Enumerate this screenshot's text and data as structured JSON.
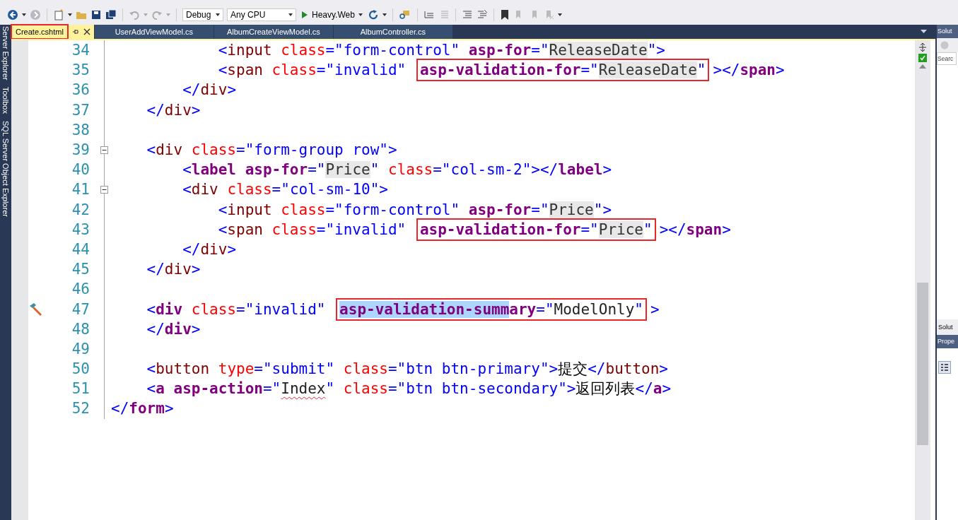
{
  "toolbar": {
    "configuration": "Debug",
    "platform": "Any CPU",
    "startup": "Heavy.Web"
  },
  "tabs": [
    {
      "label": "Create.cshtml",
      "selected": true,
      "boxed": true
    },
    {
      "label": "UserAddViewModel.cs",
      "selected": false,
      "boxed": false
    },
    {
      "label": "AlbumCreateViewModel.cs",
      "selected": false,
      "boxed": false
    },
    {
      "label": "AlbumController.cs",
      "selected": false,
      "boxed": false
    }
  ],
  "side_tabs": [
    "Server Explorer",
    "Toolbox",
    "SQL Server Object Explorer"
  ],
  "lines": [
    {
      "children": [
        {
          "children": [
            {
              "children": [
                {
                  "number": "34",
                  "segments": [
                    {
                      "boxed": false,
                      "tokens": [
                        {
                          "kind": "delim",
                          "text": "<"
                        },
                        {
                          "kind": "tag",
                          "text": "input "
                        },
                        {
                          "kind": "attr",
                          "text": "class"
                        },
                        {
                          "kind": "delim",
                          "text": "=\"form-control\" "
                        },
                        {
                          "kind": "helper",
                          "text": "asp-for"
                        },
                        {
                          "kind": "delim",
                          "text": "=\""
                        },
                        {
                          "kind": "model",
                          "text": "ReleaseDate"
                        },
                        {
                          "kind": "delim",
                          "text": "\">"
                        }
                      ]
                    }
                  ]
                },
                {
                  "number": "35",
                  "segments": [
                    {
                      "boxed": false,
                      "tokens": [
                        {
                          "kind": "delim",
                          "text": "<"
                        },
                        {
                          "kind": "tag",
                          "text": "span "
                        },
                        {
                          "kind": "attr",
                          "text": "class"
                        },
                        {
                          "kind": "delim",
                          "text": "=\"invalid\" "
                        }
                      ]
                    },
                    {
                      "boxed": true,
                      "tokens": [
                        {
                          "kind": "helper",
                          "text": "asp-validation-for"
                        },
                        {
                          "kind": "delim",
                          "text": "=\""
                        },
                        {
                          "kind": "model",
                          "text": "ReleaseDate"
                        },
                        {
                          "kind": "delim",
                          "text": "\""
                        }
                      ]
                    },
                    {
                      "boxed": false,
                      "tokens": [
                        {
                          "kind": "delim",
                          "text": "></"
                        },
                        {
                          "kind": "helper",
                          "text": "span"
                        },
                        {
                          "kind": "delim",
                          "text": ">"
                        }
                      ]
                    }
                  ]
                }
              ]
            },
            {
              "number": "36",
              "segments": [
                {
                  "boxed": false,
                  "tokens": [
                    {
                      "kind": "delim",
                      "text": "</"
                    },
                    {
                      "kind": "tag",
                      "text": "div"
                    },
                    {
                      "kind": "delim",
                      "text": ">"
                    }
                  ]
                }
              ]
            }
          ]
        },
        {
          "number": "37",
          "segments": [
            {
              "boxed": false,
              "tokens": [
                {
                  "kind": "delim",
                  "text": "</"
                },
                {
                  "kind": "tag",
                  "text": "div"
                },
                {
                  "kind": "delim",
                  "text": ">"
                }
              ]
            }
          ]
        },
        {
          "number": "38"
        },
        {
          "number": "39",
          "fold": true,
          "segments": [
            {
              "boxed": false,
              "tokens": [
                {
                  "kind": "delim",
                  "text": "<"
                },
                {
                  "kind": "tag",
                  "text": "div "
                },
                {
                  "kind": "attr",
                  "text": "class"
                },
                {
                  "kind": "delim",
                  "text": "=\"form-group row\">"
                }
              ]
            }
          ]
        },
        {
          "children": [
            {
              "number": "40",
              "segments": [
                {
                  "boxed": false,
                  "tokens": [
                    {
                      "kind": "delim",
                      "text": "<"
                    },
                    {
                      "kind": "helper",
                      "text": "label asp-for"
                    },
                    {
                      "kind": "delim",
                      "text": "=\""
                    },
                    {
                      "kind": "model",
                      "text": "Price"
                    },
                    {
                      "kind": "delim",
                      "text": "\" "
                    },
                    {
                      "kind": "attr",
                      "text": "class"
                    },
                    {
                      "kind": "delim",
                      "text": "=\"col-sm-2\"></"
                    },
                    {
                      "kind": "helper",
                      "text": "label"
                    },
                    {
                      "kind": "delim",
                      "text": ">"
                    }
                  ]
                }
              ]
            },
            {
              "number": "41",
              "fold": true,
              "segments": [
                {
                  "boxed": false,
                  "tokens": [
                    {
                      "kind": "delim",
                      "text": "<"
                    },
                    {
                      "kind": "tag",
                      "text": "div "
                    },
                    {
                      "kind": "attr",
                      "text": "class"
                    },
                    {
                      "kind": "delim",
                      "text": "=\"col-sm-10\">"
                    }
                  ]
                }
              ]
            },
            {
              "children": [
                {
                  "number": "42",
                  "segments": [
                    {
                      "boxed": false,
                      "tokens": [
                        {
                          "kind": "delim",
                          "text": "<"
                        },
                        {
                          "kind": "tag",
                          "text": "input "
                        },
                        {
                          "kind": "attr",
                          "text": "class"
                        },
                        {
                          "kind": "delim",
                          "text": "=\"form-control\" "
                        },
                        {
                          "kind": "helper",
                          "text": "asp-for"
                        },
                        {
                          "kind": "delim",
                          "text": "=\""
                        },
                        {
                          "kind": "model",
                          "text": "Price"
                        },
                        {
                          "kind": "delim",
                          "text": "\">"
                        }
                      ]
                    }
                  ]
                },
                {
                  "number": "43",
                  "segments": [
                    {
                      "boxed": false,
                      "tokens": [
                        {
                          "kind": "delim",
                          "text": "<"
                        },
                        {
                          "kind": "tag",
                          "text": "span "
                        },
                        {
                          "kind": "attr",
                          "text": "class"
                        },
                        {
                          "kind": "delim",
                          "text": "=\"invalid\" "
                        }
                      ]
                    },
                    {
                      "boxed": true,
                      "tokens": [
                        {
                          "kind": "helper",
                          "text": "asp-validation-for"
                        },
                        {
                          "kind": "delim",
                          "text": "=\""
                        },
                        {
                          "kind": "model",
                          "text": "Price"
                        },
                        {
                          "kind": "delim",
                          "text": "\""
                        }
                      ]
                    },
                    {
                      "boxed": false,
                      "tokens": [
                        {
                          "kind": "delim",
                          "text": "></"
                        },
                        {
                          "kind": "helper",
                          "text": "span"
                        },
                        {
                          "kind": "delim",
                          "text": ">"
                        }
                      ]
                    }
                  ]
                }
              ]
            },
            {
              "number": "44",
              "segments": [
                {
                  "boxed": false,
                  "tokens": [
                    {
                      "kind": "delim",
                      "text": "</"
                    },
                    {
                      "kind": "tag",
                      "text": "div"
                    },
                    {
                      "kind": "delim",
                      "text": ">"
                    }
                  ]
                }
              ]
            }
          ]
        },
        {
          "number": "45",
          "segments": [
            {
              "boxed": false,
              "tokens": [
                {
                  "kind": "delim",
                  "text": "</"
                },
                {
                  "kind": "tag",
                  "text": "div"
                },
                {
                  "kind": "delim",
                  "text": ">"
                }
              ]
            }
          ]
        },
        {
          "number": "46"
        },
        {
          "number": "47",
          "hammer": true,
          "segments": [
            {
              "boxed": false,
              "tokens": [
                {
                  "kind": "delim",
                  "text": "<"
                },
                {
                  "kind": "helper",
                  "text": "div "
                },
                {
                  "kind": "attr",
                  "text": "class"
                },
                {
                  "kind": "delim",
                  "text": "=\"invalid\" "
                }
              ]
            },
            {
              "boxed": true,
              "tokens": [
                {
                  "kind": "helper",
                  "text": "asp-validation-summ",
                  "selected": true
                },
                {
                  "kind": "helper",
                  "text": "ary",
                  "selected": false
                },
                {
                  "kind": "delim",
                  "text": "=\""
                },
                {
                  "kind": "value",
                  "text": "ModelOnly"
                },
                {
                  "kind": "delim",
                  "text": "\""
                }
              ]
            },
            {
              "boxed": false,
              "tokens": [
                {
                  "kind": "delim",
                  "text": ">"
                }
              ]
            }
          ]
        },
        {
          "number": "48",
          "segments": [
            {
              "boxed": false,
              "tokens": [
                {
                  "kind": "delim",
                  "text": "</"
                },
                {
                  "kind": "helper",
                  "text": "div"
                },
                {
                  "kind": "delim",
                  "text": ">"
                }
              ]
            }
          ]
        },
        {
          "number": "49"
        },
        {
          "number": "50",
          "segments": [
            {
              "boxed": false,
              "tokens": [
                {
                  "kind": "delim",
                  "text": "<"
                },
                {
                  "kind": "tag",
                  "text": "button "
                },
                {
                  "kind": "attr",
                  "text": "type"
                },
                {
                  "kind": "delim",
                  "text": "=\"submit\" "
                },
                {
                  "kind": "attr",
                  "text": "class"
                },
                {
                  "kind": "delim",
                  "text": "=\"btn btn-primary\">"
                },
                {
                  "kind": "text",
                  "text": "提交"
                },
                {
                  "kind": "delim",
                  "text": "</"
                },
                {
                  "kind": "tag",
                  "text": "button"
                },
                {
                  "kind": "delim",
                  "text": ">"
                }
              ]
            }
          ]
        },
        {
          "number": "51",
          "segments": [
            {
              "boxed": false,
              "tokens": [
                {
                  "kind": "delim",
                  "text": "<"
                },
                {
                  "kind": "helper",
                  "text": "a asp-action"
                },
                {
                  "kind": "delim",
                  "text": "=\""
                },
                {
                  "kind": "value",
                  "text": "Index",
                  "squiggle": true
                },
                {
                  "kind": "delim",
                  "text": "\" "
                },
                {
                  "kind": "attr",
                  "text": "class"
                },
                {
                  "kind": "delim",
                  "text": "=\"btn btn-secondary\">"
                },
                {
                  "kind": "text",
                  "text": "返回列表"
                },
                {
                  "kind": "delim",
                  "text": "</"
                },
                {
                  "kind": "helper",
                  "text": "a"
                },
                {
                  "kind": "delim",
                  "text": ">"
                }
              ]
            }
          ]
        }
      ]
    },
    {
      "number": "52",
      "segments": [
        {
          "boxed": false,
          "tokens": [
            {
              "kind": "delim",
              "text": "</"
            },
            {
              "kind": "helper",
              "text": "form"
            },
            {
              "kind": "delim",
              "text": ">"
            }
          ]
        }
      ]
    }
  ],
  "right_panel": {
    "title": "Solut",
    "search_placeholder": "Searc",
    "bottom_tab": "Solut",
    "properties_title": "Prope"
  }
}
